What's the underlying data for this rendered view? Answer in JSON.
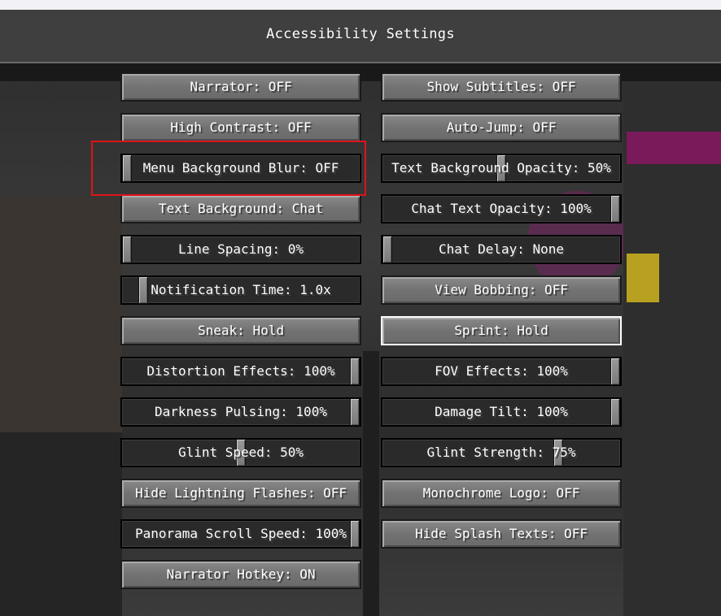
{
  "title": "Accessibility Settings",
  "buttons": {
    "narrator": "Narrator: OFF",
    "show_subtitles": "Show Subtitles: OFF",
    "high_contrast": "High Contrast: OFF",
    "auto_jump": "Auto-Jump: OFF",
    "text_background": "Text Background: Chat",
    "view_bobbing": "View Bobbing: OFF",
    "sneak": "Sneak: Hold",
    "sprint": "Sprint: Hold",
    "hide_lightning": "Hide Lightning Flashes: OFF",
    "monochrome_logo": "Monochrome Logo: OFF",
    "hide_splash": "Hide Splash Texts: OFF",
    "narrator_hotkey": "Narrator Hotkey: ON"
  },
  "sliders": {
    "menu_blur": "Menu Background Blur: OFF",
    "text_bg_opacity": "Text Background Opacity: 50%",
    "chat_text_opacity": "Chat Text Opacity: 100%",
    "line_spacing": "Line Spacing: 0%",
    "chat_delay": "Chat Delay: None",
    "notification_time": "Notification Time: 1.0x",
    "distortion": "Distortion Effects: 100%",
    "fov_effects": "FOV Effects: 100%",
    "darkness_pulsing": "Darkness Pulsing: 100%",
    "damage_tilt": "Damage Tilt: 100%",
    "glint_speed": "Glint Speed: 50%",
    "glint_strength": "Glint Strength: 75%",
    "panorama_scroll": "Panorama Scroll Speed: 100%"
  },
  "slider_levels": {
    "menu_blur": 0,
    "text_bg_opacity": 0.5,
    "chat_text_opacity": 1,
    "line_spacing": 0,
    "chat_delay": 0,
    "notification_time": 0.07,
    "distortion": 1,
    "fov_effects": 1,
    "darkness_pulsing": 1,
    "damage_tilt": 1,
    "glint_speed": 0.5,
    "glint_strength": 0.75,
    "panorama_scroll": 1
  },
  "colors": {
    "highlight_box": "#e0121a",
    "focused_border": "#ffffff"
  }
}
